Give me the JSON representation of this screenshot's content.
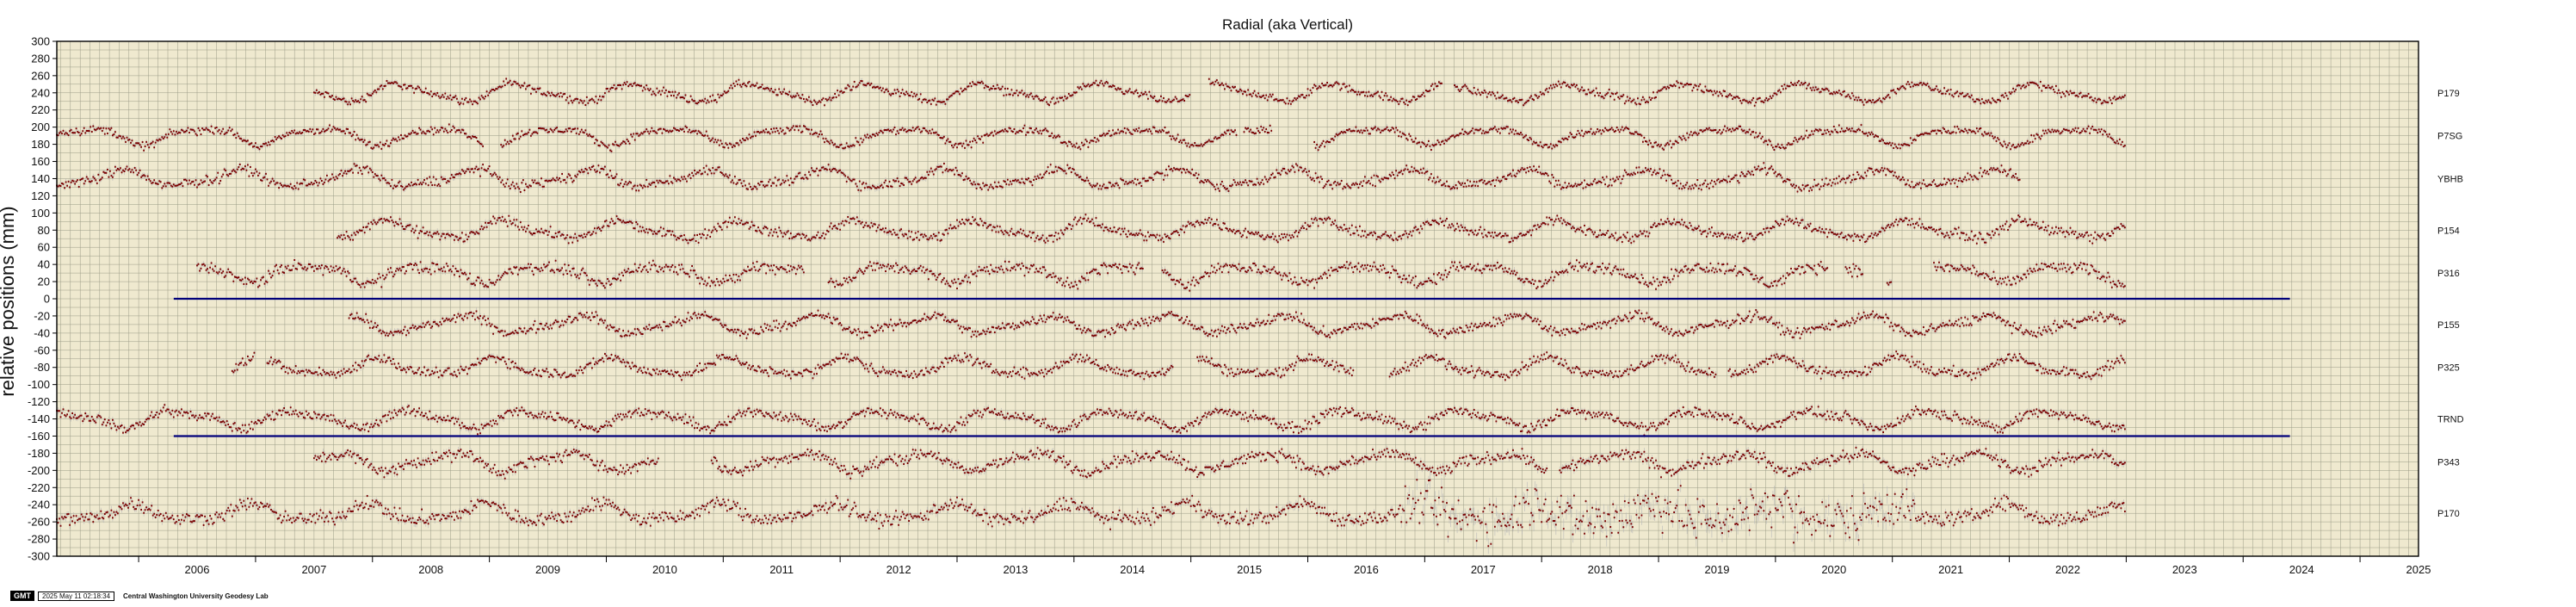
{
  "chart_data": {
    "type": "scatter",
    "title": "Radial (aka Vertical)",
    "ylabel": "relative positions (mm)",
    "xlabel": "",
    "xlim": [
      2005.3,
      2025.5
    ],
    "ylim": [
      -300,
      300
    ],
    "y_ticks": [
      300,
      280,
      260,
      240,
      220,
      200,
      180,
      160,
      140,
      120,
      100,
      80,
      60,
      40,
      20,
      0,
      -20,
      -40,
      -60,
      -80,
      -100,
      -120,
      -140,
      -160,
      -180,
      -200,
      -220,
      -240,
      -260,
      -280,
      -300
    ],
    "x_ticks": [
      "2006",
      "2007",
      "2008",
      "2009",
      "2010",
      "2011",
      "2012",
      "2013",
      "2014",
      "2015",
      "2016",
      "2017",
      "2018",
      "2019",
      "2020",
      "2021",
      "2022",
      "2023",
      "2024",
      "2025"
    ],
    "grid": true,
    "background_color": "#efe9cf",
    "point_color": "#7a0000",
    "error_color": "#b8b8b8",
    "reference_line_color": "#00007a",
    "reference_lines": [
      {
        "y": 0,
        "x_start": 2006.3,
        "x_end": 2024.4
      },
      {
        "y": -160,
        "x_start": 2006.3,
        "x_end": 2024.4
      }
    ],
    "series": [
      {
        "name": "P179",
        "offset": 240,
        "start": 2007.5,
        "end": 2023.0,
        "gaps": [
          [
            2015.0,
            2015.15
          ],
          [
            2017.15,
            2017.25
          ]
        ],
        "scatter": 4
      },
      {
        "name": "P7SG",
        "offset": 190,
        "start": 2005.3,
        "end": 2023.0,
        "gaps": [
          [
            2008.95,
            2009.1
          ],
          [
            2015.4,
            2015.45
          ],
          [
            2015.7,
            2016.05
          ]
        ],
        "scatter": 4
      },
      {
        "name": "YBHB",
        "offset": 140,
        "start": 2005.3,
        "end": 2022.1,
        "gaps": [],
        "scatter": 5
      },
      {
        "name": "P154",
        "offset": 80,
        "start": 2007.7,
        "end": 2023.0,
        "gaps": [],
        "scatter": 5
      },
      {
        "name": "P316",
        "offset": 30,
        "start": 2006.5,
        "end": 2023.0,
        "gaps": [
          [
            2011.7,
            2011.9
          ],
          [
            2014.6,
            2014.75
          ],
          [
            2020.45,
            2020.6
          ],
          [
            2020.75,
            2020.95
          ],
          [
            2021.0,
            2021.35
          ]
        ],
        "scatter": 6
      },
      {
        "name": "P155",
        "offset": -30,
        "start": 2007.8,
        "end": 2023.0,
        "gaps": [],
        "scatter": 5
      },
      {
        "name": "P325",
        "offset": -80,
        "start": 2006.8,
        "end": 2023.0,
        "gaps": [
          [
            2007.0,
            2007.1
          ],
          [
            2014.85,
            2015.05
          ],
          [
            2016.4,
            2016.7
          ],
          [
            2019.5,
            2019.6
          ]
        ],
        "scatter": 5
      },
      {
        "name": "TRND",
        "offset": -140,
        "start": 2005.3,
        "end": 2023.0,
        "gaps": [],
        "scatter": 5
      },
      {
        "name": "P343",
        "offset": -190,
        "start": 2007.5,
        "end": 2023.0,
        "gaps": [
          [
            2010.45,
            2010.9
          ],
          [
            2018.05,
            2018.15
          ]
        ],
        "scatter": 6
      },
      {
        "name": "P170",
        "offset": -250,
        "start": 2005.3,
        "end": 2023.0,
        "gaps": [],
        "scatter": 7,
        "noisy_span": [
          2016.8,
          2021.2
        ]
      }
    ]
  },
  "footer": {
    "logo": "GMT",
    "date": "2025 May 11 02:18:34",
    "lab": "Central Washington University Geodesy Lab"
  }
}
